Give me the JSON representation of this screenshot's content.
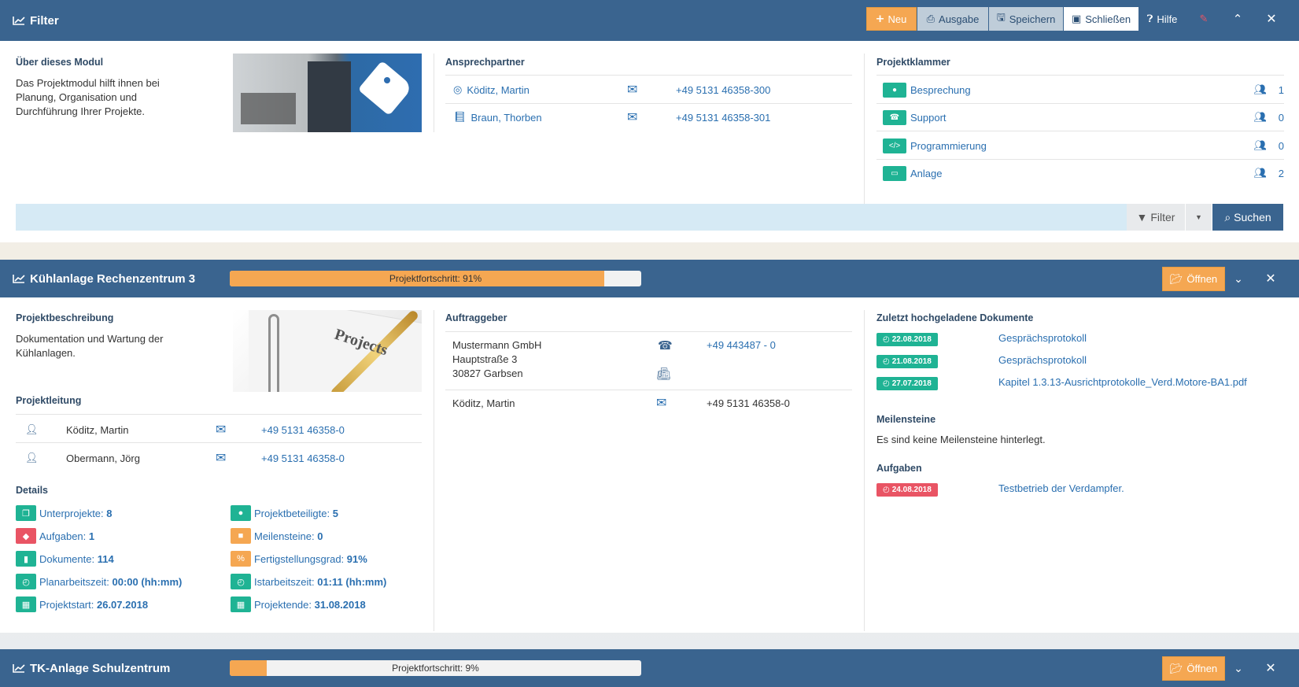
{
  "filter_panel": {
    "title": "Filter",
    "buttons": {
      "neu": "Neu",
      "ausgabe": "Ausgabe",
      "speichern": "Speichern",
      "schliessen": "Schließen",
      "hilfe": "Hilfe"
    },
    "about": {
      "heading": "Über dieses Modul",
      "text_lines": [
        "Das Projektmodul hilft ihnen bei",
        "Planung, Organisation und",
        "Durchführung Ihrer Projekte."
      ]
    },
    "contacts": {
      "heading": "Ansprechpartner",
      "rows": [
        {
          "name": "Köditz, Martin",
          "phone": "+49 5131 46358-300",
          "icon": "lifebuoy-icon"
        },
        {
          "name": "Braun, Thorben",
          "phone": "+49 5131 46358-301",
          "icon": "book-icon"
        }
      ]
    },
    "klammer": {
      "heading": "Projektklammer",
      "rows": [
        {
          "label": "Besprechung",
          "count": "1",
          "icon": "comment-icon"
        },
        {
          "label": "Support",
          "count": "0",
          "icon": "phone-icon"
        },
        {
          "label": "Programmierung",
          "count": "0",
          "icon": "code-icon"
        },
        {
          "label": "Anlage",
          "count": "2",
          "icon": "monitor-icon"
        }
      ]
    },
    "search": {
      "filter_label": "Filter",
      "suchen_label": "Suchen"
    }
  },
  "project1": {
    "title": "Kühlanlage Rechenzentrum 3",
    "progress_text": "Projektfortschritt: 91%",
    "progress": 0.91,
    "open_label": "Öffnen",
    "beschreibung": {
      "heading": "Projektbeschreibung",
      "lines": [
        "Dokumentation und Wartung der",
        "Kühlanlagen."
      ]
    },
    "image_text": "Projects",
    "leitung": {
      "heading": "Projektleitung",
      "rows": [
        {
          "name": "Köditz, Martin",
          "phone": "+49 5131 46358-0"
        },
        {
          "name": "Obermann, Jörg",
          "phone": "+49 5131 46358-0"
        }
      ]
    },
    "details": {
      "heading": "Details",
      "items": [
        {
          "label": "Unterprojekte:",
          "value": "8",
          "color": "green"
        },
        {
          "label": "Projektbeteiligte:",
          "value": "5",
          "color": "green"
        },
        {
          "label": "Aufgaben:",
          "value": "1",
          "color": "red"
        },
        {
          "label": "Meilensteine:",
          "value": "0",
          "color": "orange"
        },
        {
          "label": "Dokumente:",
          "value": "114",
          "color": "green"
        },
        {
          "label": "Fertigstellungsgrad:",
          "value": "91%",
          "color": "orange"
        },
        {
          "label": "Planarbeitszeit:",
          "value": "00:00 (hh:mm)",
          "color": "green"
        },
        {
          "label": "Istarbeitszeit:",
          "value": "01:11 (hh:mm)",
          "color": "green"
        },
        {
          "label": "Projektstart:",
          "value": "26.07.2018",
          "color": "green"
        },
        {
          "label": "Projektende:",
          "value": "31.08.2018",
          "color": "green"
        }
      ]
    },
    "auftraggeber": {
      "heading": "Auftraggeber",
      "company": [
        "Mustermann GmbH",
        "Hauptstraße 3",
        "30827 Garbsen"
      ],
      "company_phone": "+49 443487 - 0",
      "contact_name": "Köditz, Martin",
      "contact_phone": "+49 5131 46358-0"
    },
    "dokumente": {
      "heading": "Zuletzt hochgeladene Dokumente",
      "rows": [
        {
          "date": "22.08.2018",
          "name": "Gesprächsprotokoll"
        },
        {
          "date": "21.08.2018",
          "name": "Gesprächsprotokoll"
        },
        {
          "date": "27.07.2018",
          "name": "Kapitel 1.3.13-Ausrichtprotokolle_Verd.Motore-BA1.pdf"
        }
      ]
    },
    "meilensteine": {
      "heading": "Meilensteine",
      "text": "Es sind keine Meilensteine hinterlegt."
    },
    "aufgaben": {
      "heading": "Aufgaben",
      "rows": [
        {
          "date": "24.08.2018",
          "name": "Testbetrieb der Verdampfer."
        }
      ]
    }
  },
  "project2": {
    "title": "TK-Anlage Schulzentrum",
    "progress_text": "Projektfortschritt: 9%",
    "progress": 0.09,
    "open_label": "Öffnen"
  },
  "colors": {
    "header": "#3a648f",
    "accent_orange": "#f5a752",
    "green": "#1fb394",
    "red": "#e95464",
    "link": "#2a6fb0"
  }
}
